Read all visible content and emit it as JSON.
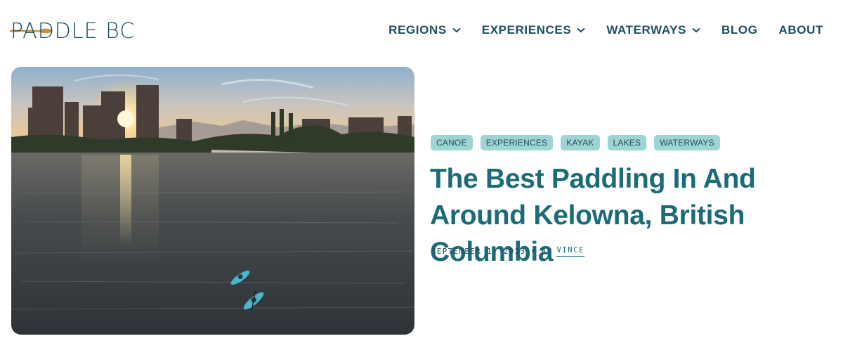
{
  "brand": {
    "name": "PADDLE BC",
    "accent": "#c8913a",
    "primary": "#1d4f5e"
  },
  "nav": {
    "items": [
      {
        "label": "REGIONS",
        "has_dropdown": true
      },
      {
        "label": "EXPERIENCES",
        "has_dropdown": true
      },
      {
        "label": "WATERWAYS",
        "has_dropdown": true
      },
      {
        "label": "BLOG",
        "has_dropdown": false
      },
      {
        "label": "ABOUT",
        "has_dropdown": false
      }
    ]
  },
  "article": {
    "tags": [
      "CANOE",
      "EXPERIENCES",
      "KAYAK",
      "LAKES",
      "WATERWAYS"
    ],
    "title": "The Best Paddling In And Around Kelowna, British Columbia",
    "date": "SEPTEMBER 1, 2023",
    "by_label": "BY",
    "author": "VINCE",
    "tag_color": "#9ed4d3",
    "title_color": "#1c6b78"
  },
  "hero_image": {
    "description_icon": "kelowna-sunset-kayakers-photo"
  }
}
